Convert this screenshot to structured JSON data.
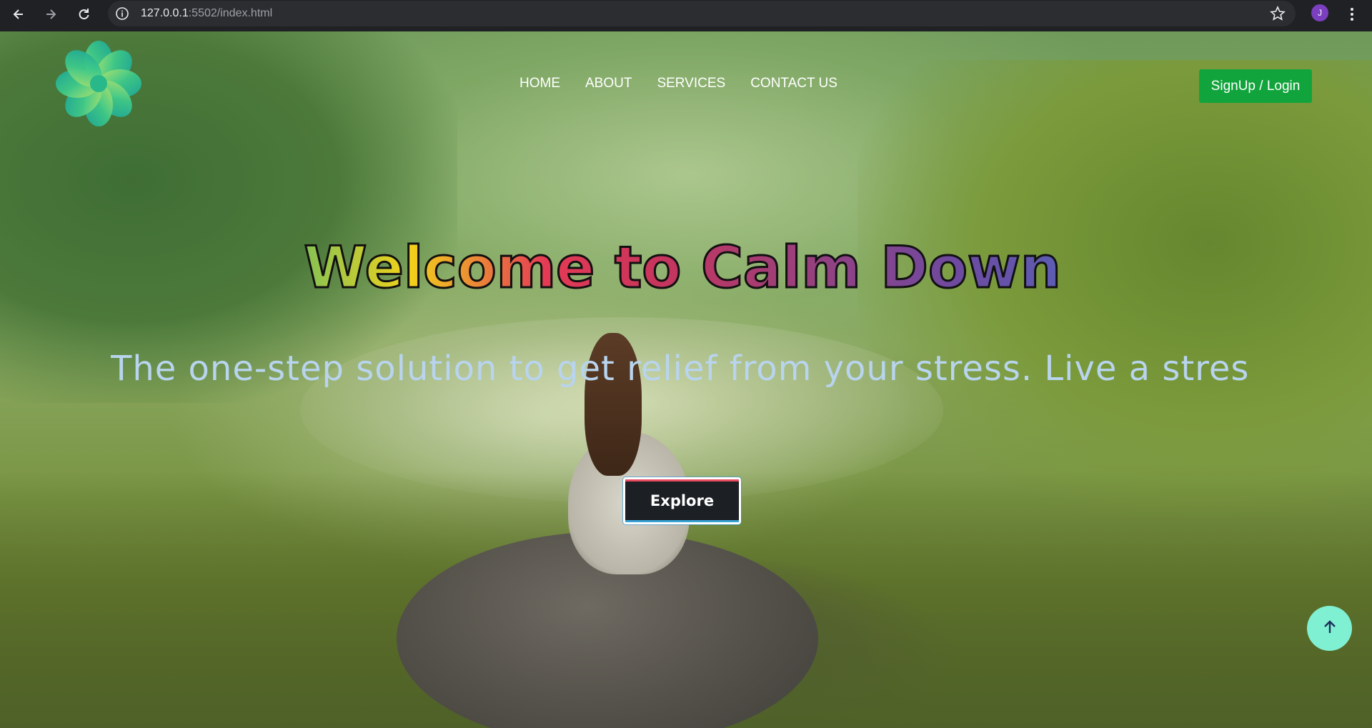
{
  "browser": {
    "url_host": "127.0.0.1",
    "url_path": ":5502/index.html",
    "profile_initial": "J",
    "icons": [
      "back-icon",
      "forward-icon",
      "reload-icon",
      "info-icon",
      "star-icon",
      "more-vert-icon"
    ]
  },
  "site": {
    "nav": [
      "HOME",
      "ABOUT",
      "SERVICES",
      "CONTACT US"
    ],
    "signup_label": "SignUp / Login",
    "accent_color": "#12a43c"
  },
  "hero": {
    "title": "Welcome to Calm Down",
    "subtitle": "The one-step solution to get relief from your stress. Live a stress-",
    "explore_label": "Explore"
  },
  "scroll_top": {
    "icon": "arrow-up-icon",
    "color": "#7ff0d1"
  }
}
